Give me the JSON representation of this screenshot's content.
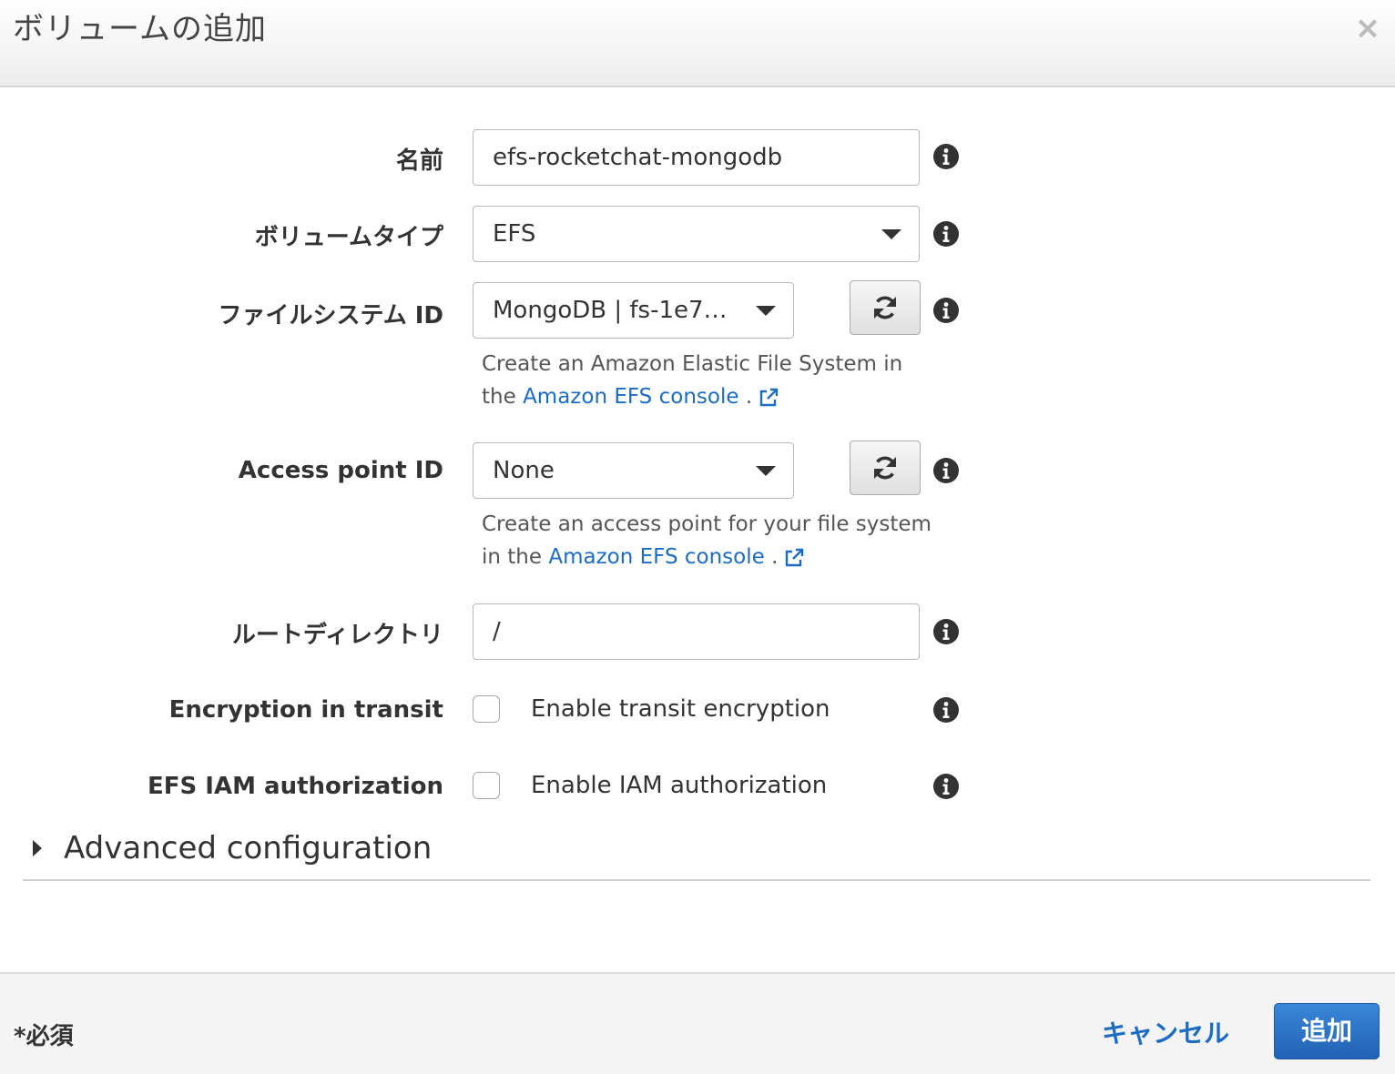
{
  "dialog": {
    "title": "ボリュームの追加",
    "close": "×"
  },
  "form": {
    "name": {
      "label": "名前",
      "value": "efs-rocketchat-mongodb"
    },
    "volume_type": {
      "label": "ボリュームタイプ",
      "value": "EFS"
    },
    "file_system_id": {
      "label": "ファイルシステム ID",
      "value": "MongoDB | fs-1e7…",
      "help_prefix_line1": "Create an Amazon Elastic File System in",
      "help_prefix_line2": "the",
      "help_link": "Amazon EFS console",
      "help_suffix": "."
    },
    "access_point_id": {
      "label": "Access point ID",
      "value": "None",
      "help_prefix_line1": "Create an access point for your file system",
      "help_prefix_line2": "in the",
      "help_link": "Amazon EFS console",
      "help_suffix": "."
    },
    "root_directory": {
      "label": "ルートディレクトリ",
      "value": "/"
    },
    "encryption_in_transit": {
      "label": "Encryption in transit",
      "checkbox_label": "Enable transit encryption",
      "checked": false
    },
    "efs_iam_authorization": {
      "label": "EFS IAM authorization",
      "checkbox_label": "Enable IAM authorization",
      "checked": false
    },
    "advanced": {
      "label": "Advanced configuration"
    }
  },
  "footer": {
    "required": "*必須",
    "cancel": "キャンセル",
    "add": "追加"
  },
  "colors": {
    "link": "#1b6cc2",
    "primary_button": "#2b73c6",
    "info_icon": "#333333"
  },
  "icons": [
    "close-icon",
    "info-icon",
    "caret-down-icon",
    "refresh-icon",
    "external-link-icon",
    "caret-right-icon"
  ]
}
